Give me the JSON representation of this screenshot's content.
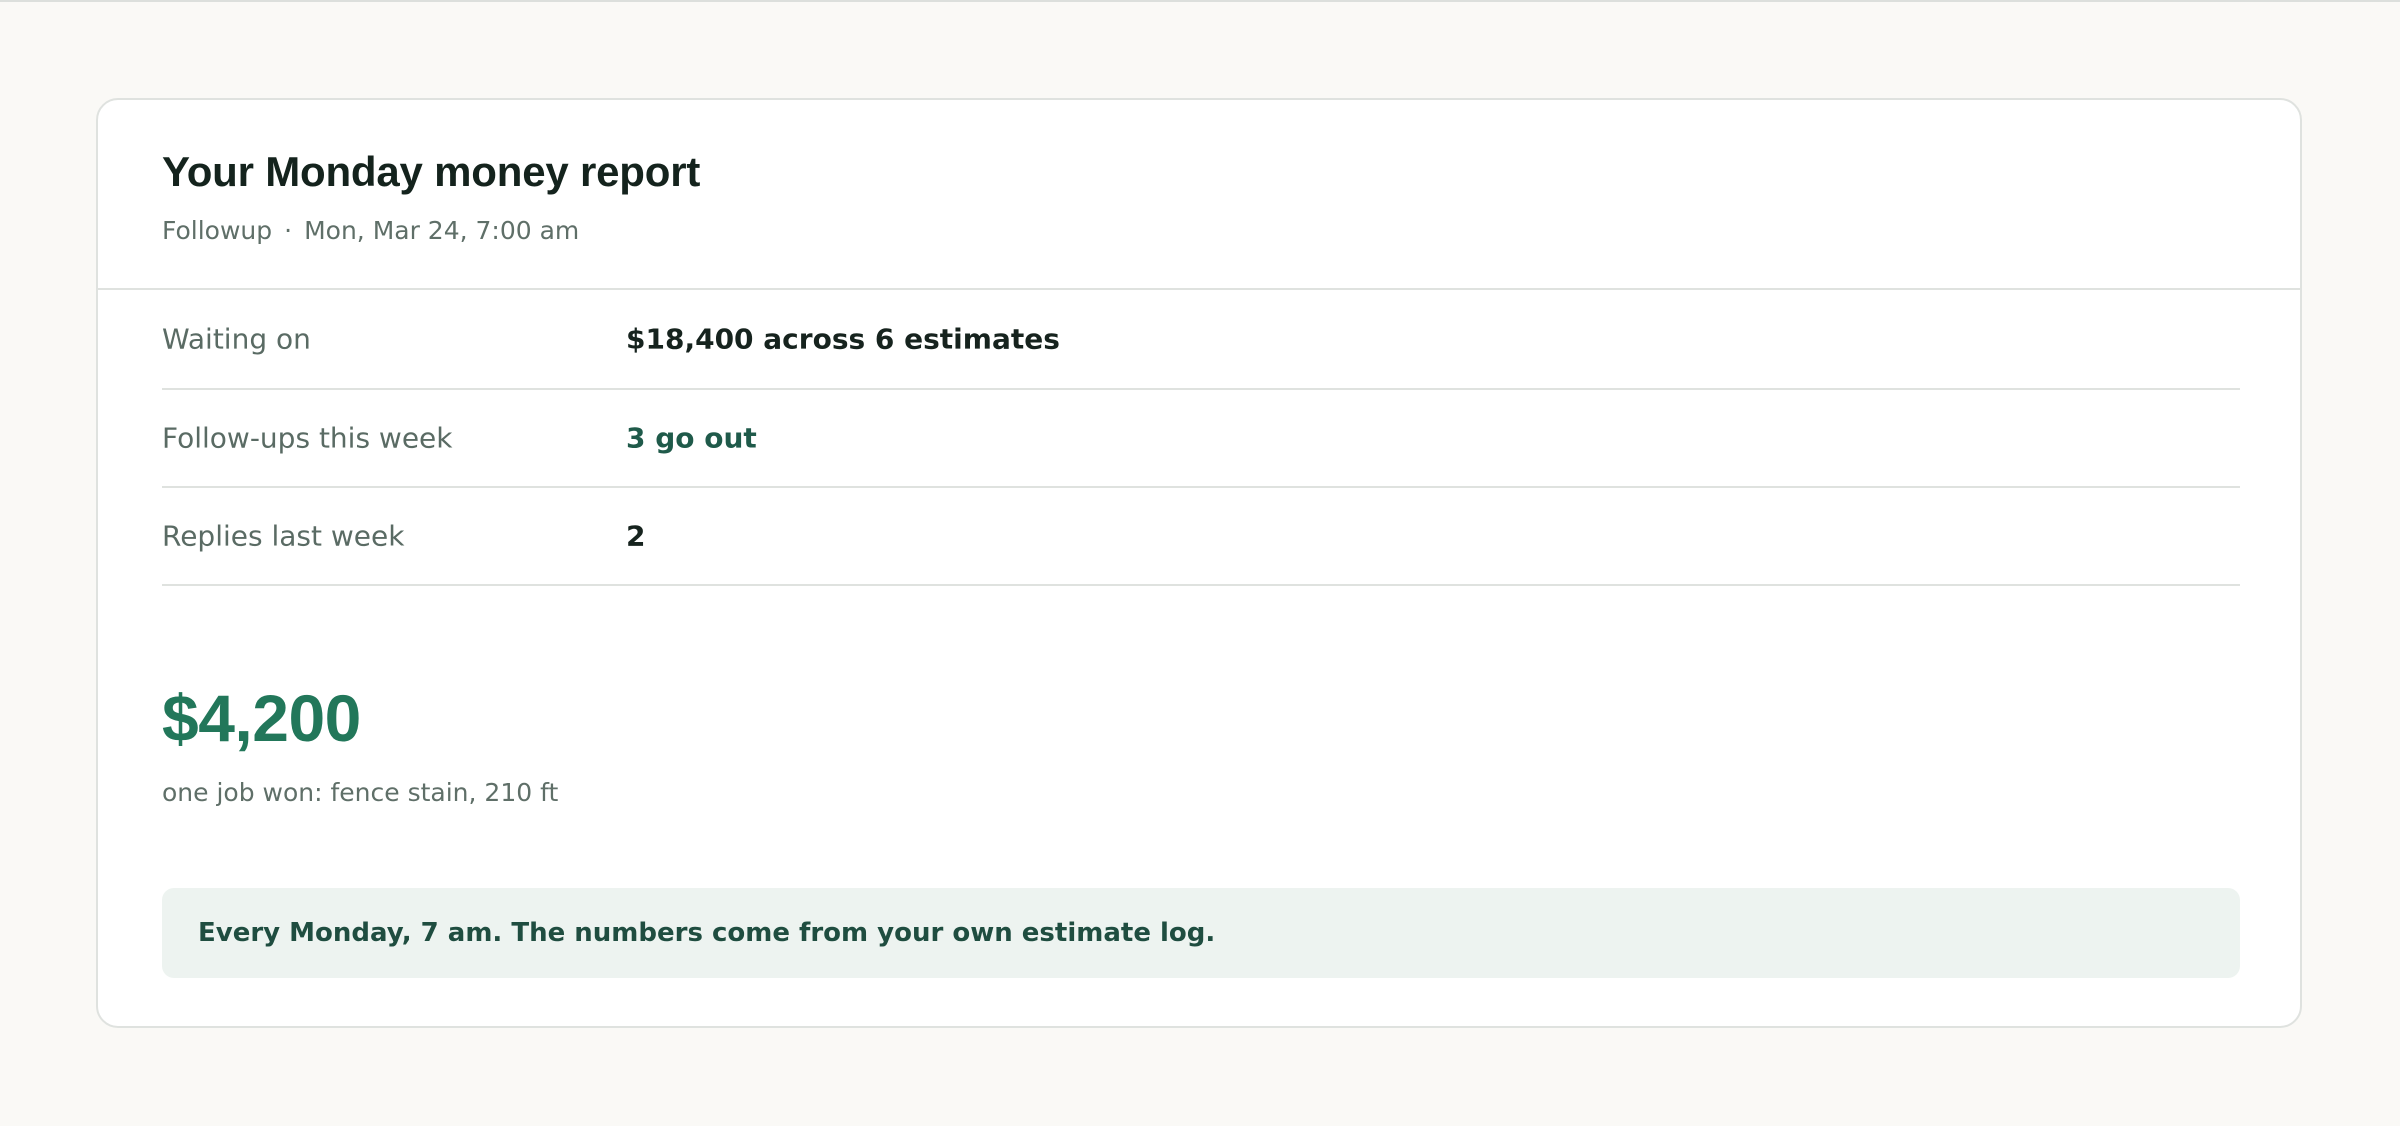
{
  "report": {
    "title": "Your Monday money report",
    "sender": "Followup",
    "separator": "·",
    "date": "Mon, Mar 24, 7:00 am"
  },
  "rows": [
    {
      "label": "Waiting on",
      "value": "$18,400 across 6 estimates"
    },
    {
      "label": "Follow-ups this week",
      "value": "3 go out"
    },
    {
      "label": "Replies last week",
      "value": "2"
    }
  ],
  "highlight": {
    "amount": "$4,200",
    "caption": "one job won: fence stain, 210 ft"
  },
  "note": {
    "text": "Every Monday, 7 am. The numbers come from your own estimate log."
  },
  "colors": {
    "page_background": "#faf9f6",
    "card_background": "#ffffff",
    "accent_green": "#22775a",
    "dark_green_text": "#1f5a4a",
    "note_background": "#edf3f0"
  }
}
